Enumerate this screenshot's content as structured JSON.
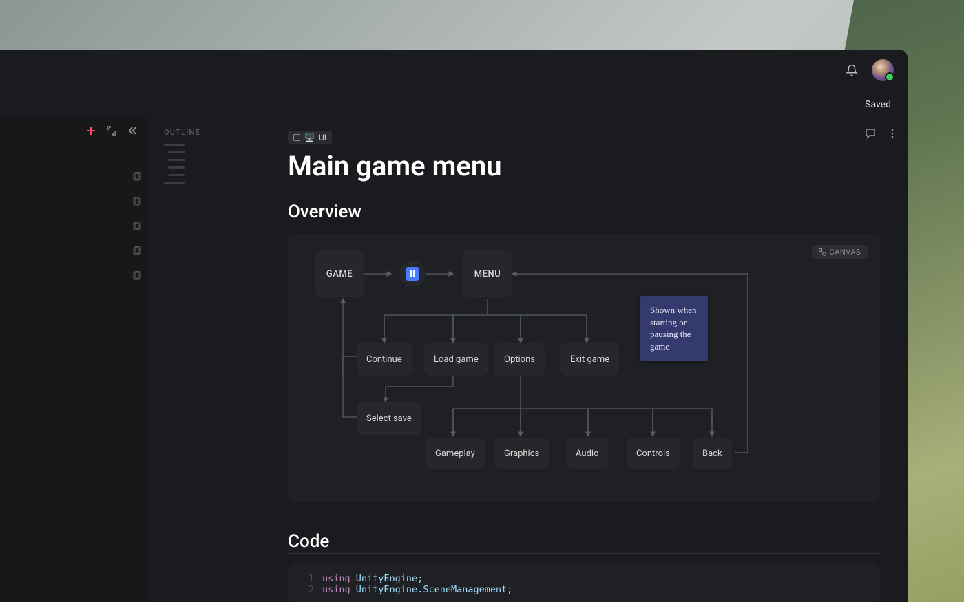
{
  "header": {
    "saved_label": "Saved"
  },
  "breadcrumb": {
    "icon": "🖥️",
    "label": "UI"
  },
  "page": {
    "title": "Main game menu"
  },
  "sections": {
    "overview": "Overview",
    "code": "Code"
  },
  "outline": {
    "title": "OUTLINE"
  },
  "canvas": {
    "badge": "CANVAS",
    "nodes": {
      "game": "GAME",
      "menu": "MENU",
      "continue": "Continue",
      "load_game": "Load game",
      "options": "Options",
      "exit_game": "Exit game",
      "select_save": "Select save",
      "gameplay": "Gameplay",
      "graphics": "Graphics",
      "audio": "Audio",
      "controls": "Controls",
      "back": "Back"
    },
    "sticky": "Shown when starting or pausing the game"
  },
  "code": {
    "lines": [
      {
        "n": "1",
        "kw": "using",
        "ns": "UnityEngine",
        "suffix": ";"
      },
      {
        "n": "2",
        "kw": "using",
        "ns": "UnityEngine.SceneManagement",
        "suffix": ";"
      }
    ]
  }
}
